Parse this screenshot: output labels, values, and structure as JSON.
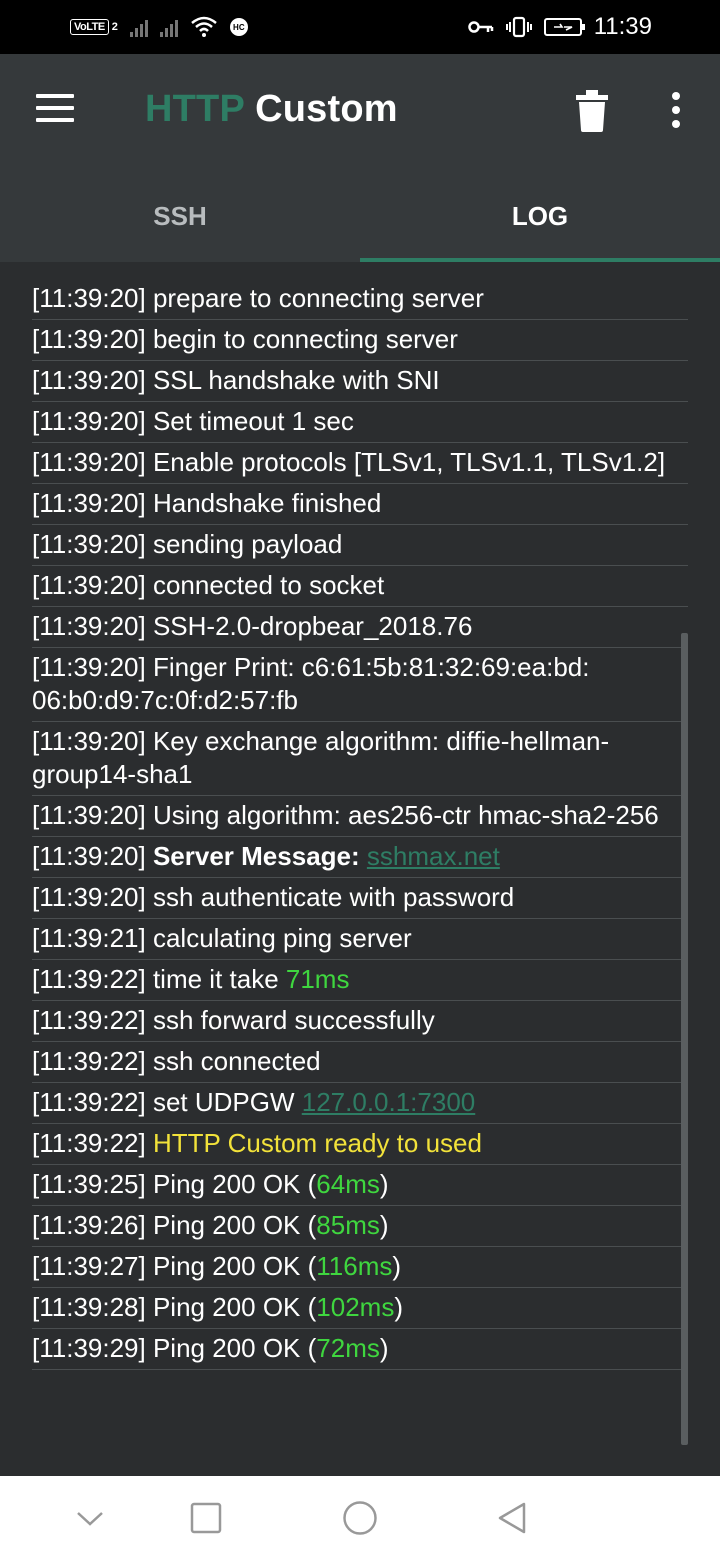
{
  "status_bar": {
    "volte": "VoLTE",
    "sim": "2",
    "hc": "HC",
    "time": "11:39",
    "icons": [
      "signal-icon",
      "wifi-icon",
      "key-icon",
      "vibrate-icon",
      "battery-icon"
    ]
  },
  "app_bar": {
    "title_accent": "HTTP",
    "title_main": "Custom",
    "accent_color": "#2e7d64"
  },
  "tabs": [
    {
      "label": "SSH",
      "active": false
    },
    {
      "label": "LOG",
      "active": true
    }
  ],
  "log": [
    {
      "time": "[11:39:20]",
      "parts": [
        {
          "text": " prepare to connecting server"
        }
      ]
    },
    {
      "time": "[11:39:20]",
      "parts": [
        {
          "text": " begin to connecting server"
        }
      ]
    },
    {
      "time": "[11:39:20]",
      "parts": [
        {
          "text": " SSL handshake with SNI"
        }
      ]
    },
    {
      "time": "[11:39:20]",
      "parts": [
        {
          "text": " Set timeout 1 sec"
        }
      ]
    },
    {
      "time": "[11:39:20]",
      "parts": [
        {
          "text": " Enable protocols [TLSv1, TLSv1.1, TLSv1.2]"
        }
      ]
    },
    {
      "time": "[11:39:20]",
      "parts": [
        {
          "text": " Handshake finished"
        }
      ]
    },
    {
      "time": "[11:39:20]",
      "parts": [
        {
          "text": " sending payload"
        }
      ]
    },
    {
      "time": "[11:39:20]",
      "parts": [
        {
          "text": " connected to socket"
        }
      ]
    },
    {
      "time": "[11:39:20]",
      "parts": [
        {
          "text": " SSH-2.0-dropbear_2018.76"
        }
      ]
    },
    {
      "time": "[11:39:20]",
      "parts": [
        {
          "text": " Finger Print: c6:61:5b:81:32:69:ea:bd: 06:b0:d9:7c:0f:d2:57:fb"
        }
      ]
    },
    {
      "time": "[11:39:20]",
      "parts": [
        {
          "text": " Key exchange algorithm: diffie-hellman-group14-sha1"
        }
      ]
    },
    {
      "time": "[11:39:20]",
      "parts": [
        {
          "text": " Using algorithm: aes256-ctr hmac-sha2-256"
        }
      ]
    },
    {
      "time": "[11:39:20]",
      "parts": [
        {
          "text": " "
        },
        {
          "text": "Server Message:",
          "style": "bold"
        },
        {
          "text": " "
        },
        {
          "text": "sshmax.net",
          "style": "link"
        }
      ]
    },
    {
      "time": "[11:39:20]",
      "parts": [
        {
          "text": " ssh authenticate with password"
        }
      ]
    },
    {
      "time": "[11:39:21]",
      "parts": [
        {
          "text": " calculating ping server"
        }
      ]
    },
    {
      "time": "[11:39:22]",
      "parts": [
        {
          "text": " time it take "
        },
        {
          "text": "71ms",
          "style": "green"
        }
      ]
    },
    {
      "time": "[11:39:22]",
      "parts": [
        {
          "text": " ssh forward successfully"
        }
      ]
    },
    {
      "time": "[11:39:22]",
      "parts": [
        {
          "text": " ssh connected"
        }
      ]
    },
    {
      "time": "[11:39:22]",
      "parts": [
        {
          "text": " set UDPGW "
        },
        {
          "text": "127.0.0.1:7300",
          "style": "link"
        }
      ]
    },
    {
      "time": "[11:39:22]",
      "parts": [
        {
          "text": " "
        },
        {
          "text": "HTTP Custom ready to used",
          "style": "yellow"
        }
      ]
    },
    {
      "time": "[11:39:25]",
      "parts": [
        {
          "text": " Ping 200 OK ("
        },
        {
          "text": "64ms",
          "style": "green"
        },
        {
          "text": ")"
        }
      ]
    },
    {
      "time": "[11:39:26]",
      "parts": [
        {
          "text": " Ping 200 OK ("
        },
        {
          "text": "85ms",
          "style": "green"
        },
        {
          "text": ")"
        }
      ]
    },
    {
      "time": "[11:39:27]",
      "parts": [
        {
          "text": " Ping 200 OK ("
        },
        {
          "text": "116ms",
          "style": "green"
        },
        {
          "text": ")"
        }
      ]
    },
    {
      "time": "[11:39:28]",
      "parts": [
        {
          "text": " Ping 200 OK ("
        },
        {
          "text": "102ms",
          "style": "green"
        },
        {
          "text": ")"
        }
      ]
    },
    {
      "time": "[11:39:29]",
      "parts": [
        {
          "text": " Ping 200 OK ("
        },
        {
          "text": "72ms",
          "style": "green"
        },
        {
          "text": ")"
        }
      ]
    }
  ],
  "colors": {
    "green": "#3fd63f",
    "link": "#2e7d64",
    "yellow": "#f2e23a"
  }
}
